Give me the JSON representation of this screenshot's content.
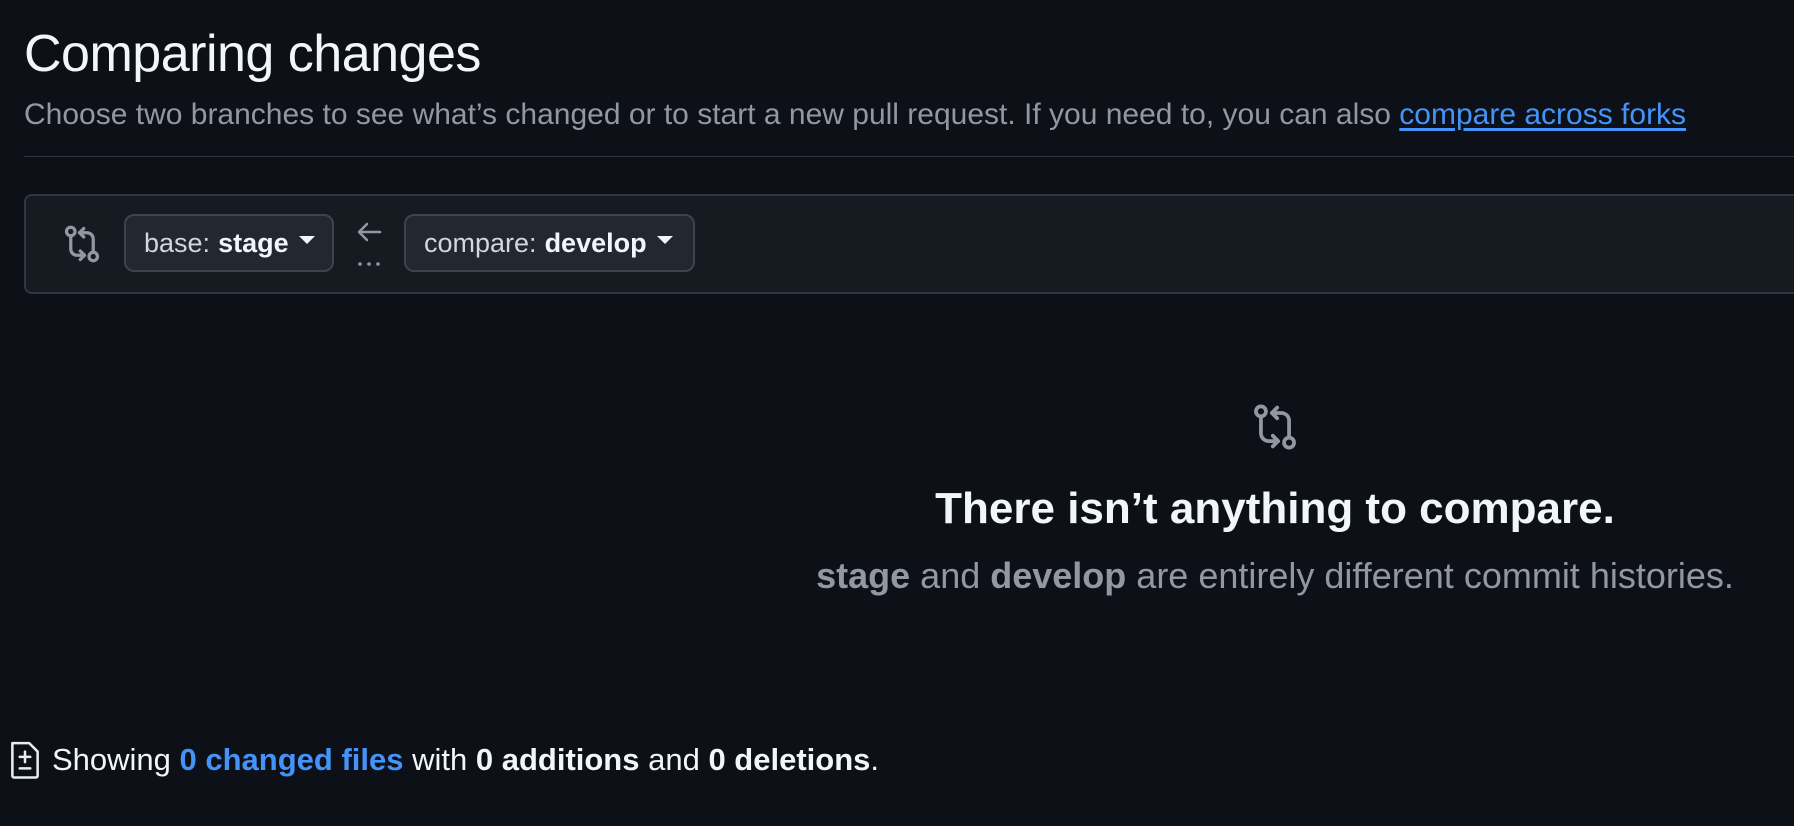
{
  "header": {
    "title": "Comparing changes",
    "subtitle_text": "Choose two branches to see what’s changed or to start a new pull request. If you need to, you can also ",
    "subtitle_link": "compare across forks"
  },
  "range": {
    "icon": "git-compare-icon",
    "base_label": "base:",
    "base_value": "stage",
    "swap_icon": "arrow-left-icon",
    "swap_dots": "...",
    "compare_label": "compare:",
    "compare_value": "develop"
  },
  "empty_state": {
    "icon": "git-compare-icon",
    "title": "There isn’t anything to compare.",
    "branch_a": "stage",
    "and_text": " and ",
    "branch_b": "develop",
    "suffix": " are entirely different commit histories."
  },
  "summary": {
    "icon": "file-diff-icon",
    "prefix": "Showing ",
    "changed_files": "0 changed files",
    "with_text": " with ",
    "additions": "0 additions",
    "and_text": " and ",
    "deletions": "0 deletions",
    "end": "."
  },
  "colors": {
    "background": "#0d1117",
    "link": "#4493f8",
    "muted": "#9198a1",
    "border": "#30363d"
  }
}
